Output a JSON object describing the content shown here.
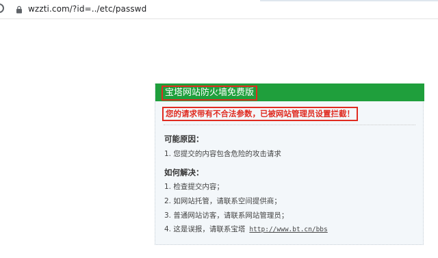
{
  "browser": {
    "url": "wzzti.com/?id=../etc/passwd",
    "lock_icon": "lock-icon"
  },
  "waf_page": {
    "title": "宝塔网站防火墙免费版",
    "alert": "您的请求带有不合法参数，已被网站管理员设置拦截！",
    "reasons_heading": "可能原因：",
    "reasons": [
      "1. 您提交的内容包含危险的攻击请求"
    ],
    "solutions_heading": "如何解决：",
    "solutions": [
      "1. 检查提交内容；",
      "2. 如网站托管，请联系空间提供商；",
      "3. 普通网站访客，请联系网站管理员；",
      "4. 这是误报，请联系宝塔"
    ],
    "contact_link": "http://www.bt.cn/bbs",
    "colors": {
      "header": "#1f9f3c",
      "alert": "#e02b20",
      "panel_bg": "#f3f7fa"
    }
  }
}
